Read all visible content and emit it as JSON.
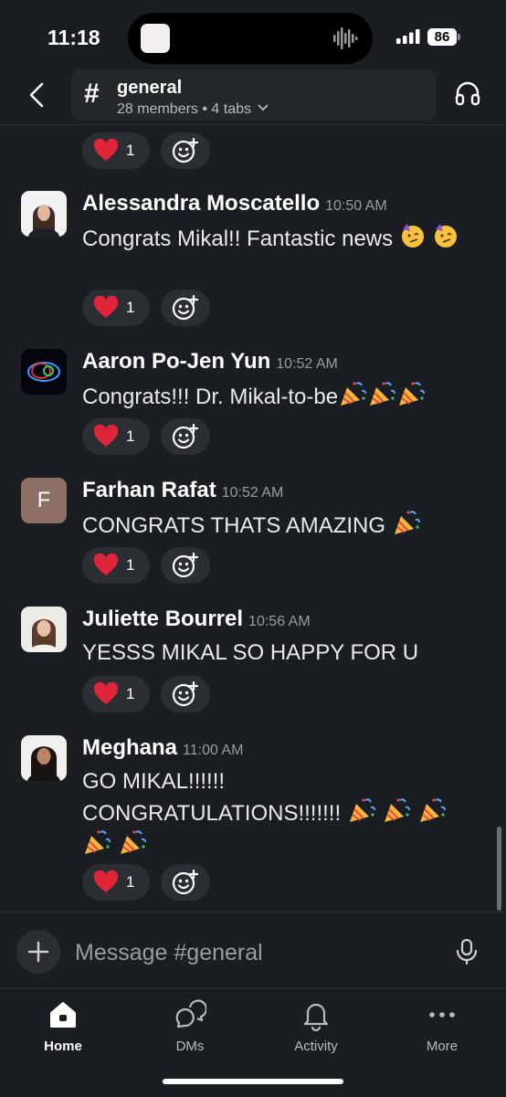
{
  "status_bar": {
    "time": "11:18",
    "battery": "86"
  },
  "header": {
    "channel_name": "general",
    "channel_meta": "28 members • 4 tabs",
    "hash_symbol": "#"
  },
  "top_reaction": {
    "count": "1"
  },
  "messages": [
    {
      "author": "Alessandra Moscatello",
      "time": "10:50 AM",
      "text": "Congrats Mikal!! Fantastic news",
      "reaction_count": "1"
    },
    {
      "author": "Aaron Po-Jen Yun",
      "time": "10:52 AM",
      "text": "Congrats!!! Dr. Mikal-to-be",
      "reaction_count": "1"
    },
    {
      "author": "Farhan Rafat",
      "time": "10:52 AM",
      "text": "CONGRATS THATS AMAZING",
      "reaction_count": "1",
      "avatar_initial": "F"
    },
    {
      "author": "Juliette Bourrel",
      "time": "10:56 AM",
      "text": "YESSS MIKAL SO HAPPY FOR U",
      "reaction_count": "1"
    },
    {
      "author": "Meghana",
      "time": "11:00 AM",
      "text_line1": "GO MIKAL!!!!!!",
      "text_line2": "CONGRATULATIONS!!!!!!!",
      "reaction_count": "1"
    }
  ],
  "composer": {
    "placeholder": "Message #general"
  },
  "tabs": [
    {
      "label": "Home",
      "icon": "home-icon"
    },
    {
      "label": "DMs",
      "icon": "dms-icon"
    },
    {
      "label": "Activity",
      "icon": "bell-icon"
    },
    {
      "label": "More",
      "icon": "more-icon"
    }
  ],
  "colors": {
    "background": "#1a1d21",
    "pill": "#2b2e32",
    "heart": "#e0243a",
    "avatar_farhan": "#8e6f63"
  }
}
